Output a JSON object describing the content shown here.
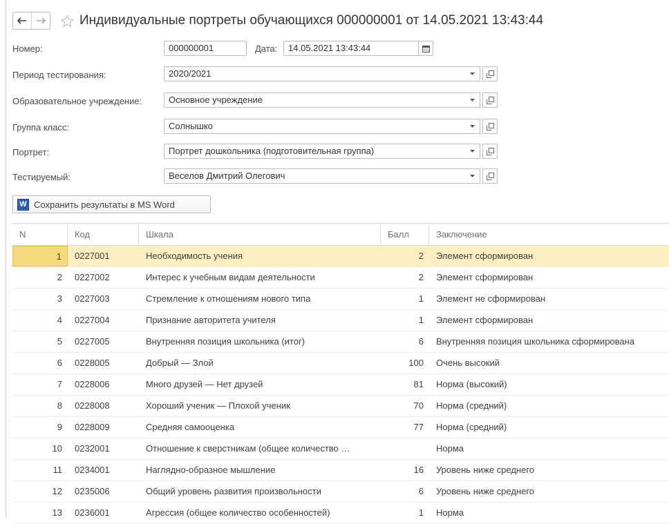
{
  "window": {
    "title": "Индивидуальные портреты обучающихся 000000001 от 14.05.2021 13:43:44"
  },
  "form": {
    "number_label": "Номер:",
    "number_value": "000000001",
    "date_label": "Дата:",
    "date_value": "14.05.2021 13:43:44",
    "period_label": "Период тестирования:",
    "period_value": "2020/2021",
    "institution_label": "Образовательное учреждение:",
    "institution_value": "Основное учреждение",
    "group_label": "Группа класс:",
    "group_value": "Солнышко",
    "portrait_label": "Портрет:",
    "portrait_value": "Портрет дошкольника (подготовительная группа)",
    "tested_label": "Тестируемый:",
    "tested_value": "Веселов Дмитрий Олегович"
  },
  "toolbar": {
    "save_word_label": "Сохранить результаты в MS Word",
    "word_icon_letter": "W"
  },
  "table": {
    "headers": {
      "n": "N",
      "kod": "Код",
      "shkala": "Шкала",
      "ball": "Балл",
      "zakl": "Заключение"
    },
    "rows": [
      {
        "n": "1",
        "kod": "0227001",
        "shkala": "Необходимость учения",
        "ball": "2",
        "zakl": "Элемент сформирован"
      },
      {
        "n": "2",
        "kod": "0227002",
        "shkala": "Интерес к учебным видам деятельности",
        "ball": "2",
        "zakl": "Элемент сформирован"
      },
      {
        "n": "3",
        "kod": "0227003",
        "shkala": "Стремление к отношениям нового типа",
        "ball": "1",
        "zakl": "Элемент не сформирован"
      },
      {
        "n": "4",
        "kod": "0227004",
        "shkala": "Признание авторитета учителя",
        "ball": "1",
        "zakl": "Элемент сформирован"
      },
      {
        "n": "5",
        "kod": "0227005",
        "shkala": "Внутренняя позиция школьника (итог)",
        "ball": "6",
        "zakl": "Внутренняя позиция школьника сформирована"
      },
      {
        "n": "6",
        "kod": "0228005",
        "shkala": "Добрый — Злой",
        "ball": "100",
        "zakl": "Очень высокий"
      },
      {
        "n": "7",
        "kod": "0228006",
        "shkala": "Много друзей — Нет друзей",
        "ball": "81",
        "zakl": "Норма (высокий)"
      },
      {
        "n": "8",
        "kod": "0228008",
        "shkala": "Хороший ученик — Плохой ученик",
        "ball": "70",
        "zakl": "Норма (средний)"
      },
      {
        "n": "9",
        "kod": "0228009",
        "shkala": "Средняя самооценка",
        "ball": "77",
        "zakl": "Норма (средний)"
      },
      {
        "n": "10",
        "kod": "0232001",
        "shkala": "Отношение к сверстникам (общее количество …",
        "ball": "",
        "zakl": "Норма"
      },
      {
        "n": "11",
        "kod": "0234001",
        "shkala": "Наглядно-образное мышление",
        "ball": "16",
        "zakl": "Уровень ниже среднего"
      },
      {
        "n": "12",
        "kod": "0235006",
        "shkala": "Общий уровень развития произвольности",
        "ball": "6",
        "zakl": "Уровень ниже среднего"
      },
      {
        "n": "13",
        "kod": "0236001",
        "shkala": "Агрессия (общее количество особенностей)",
        "ball": "1",
        "zakl": "Норма"
      }
    ]
  },
  "colors": {
    "selected_row": "#fbeec1",
    "selected_cell": "#f6d97f",
    "word_icon": "#2b5eb3"
  }
}
